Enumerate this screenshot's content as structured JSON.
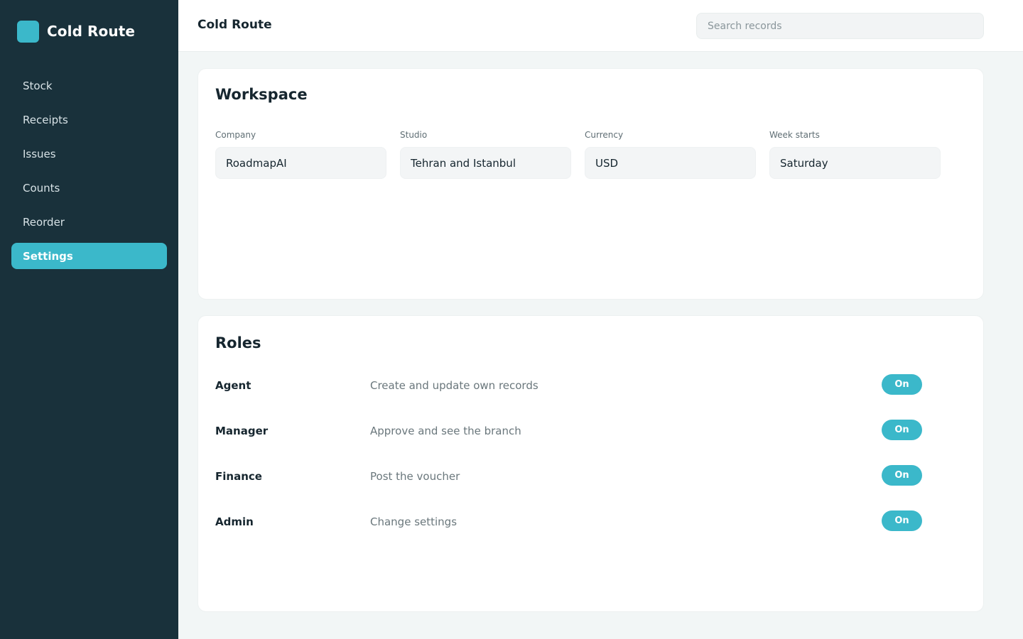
{
  "colors": {
    "accent": "#3bb8ca",
    "sidebar_bg": "#19313b",
    "page_bg": "#f2f6f6",
    "card_bg": "#ffffff"
  },
  "brand": {
    "name": "Cold Route",
    "logo_icon": "square-logo-icon"
  },
  "sidebar": {
    "items": [
      {
        "label": "Stock",
        "active": false
      },
      {
        "label": "Receipts",
        "active": false
      },
      {
        "label": "Issues",
        "active": false
      },
      {
        "label": "Counts",
        "active": false
      },
      {
        "label": "Reorder",
        "active": false
      },
      {
        "label": "Settings",
        "active": true
      }
    ]
  },
  "header": {
    "title": "Cold Route",
    "search_placeholder": "Search records"
  },
  "workspace": {
    "title": "Workspace",
    "fields": [
      {
        "label": "Company",
        "value": "RoadmapAI"
      },
      {
        "label": "Studio",
        "value": "Tehran and Istanbul"
      },
      {
        "label": "Currency",
        "value": "USD"
      },
      {
        "label": "Week starts",
        "value": "Saturday"
      }
    ]
  },
  "roles": {
    "title": "Roles",
    "rows": [
      {
        "name": "Agent",
        "description": "Create and update own records",
        "toggle": "On"
      },
      {
        "name": "Manager",
        "description": "Approve and see the branch",
        "toggle": "On"
      },
      {
        "name": "Finance",
        "description": "Post the voucher",
        "toggle": "On"
      },
      {
        "name": "Admin",
        "description": "Change settings",
        "toggle": "On"
      }
    ]
  }
}
